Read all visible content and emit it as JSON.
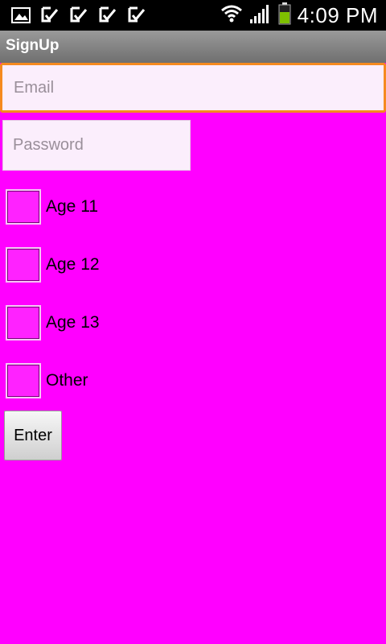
{
  "status_bar": {
    "time": "4:09 PM",
    "left_icons": [
      "image-icon",
      "download-check-icon",
      "download-check-icon",
      "download-check-icon",
      "download-check-icon"
    ],
    "right_icons": [
      "wifi-icon",
      "signal-icon",
      "battery-icon"
    ]
  },
  "app": {
    "title": "SignUp"
  },
  "form": {
    "email_placeholder": "Email",
    "password_placeholder": "Password",
    "checkboxes": [
      {
        "label": "Age 11",
        "checked": false
      },
      {
        "label": "Age 12",
        "checked": false
      },
      {
        "label": "Age 13",
        "checked": false
      },
      {
        "label": "Other",
        "checked": false
      }
    ],
    "submit_label": "Enter"
  },
  "colors": {
    "background": "#ff00ff",
    "focus_border": "#f58a1f",
    "battery": "#7ec000"
  }
}
